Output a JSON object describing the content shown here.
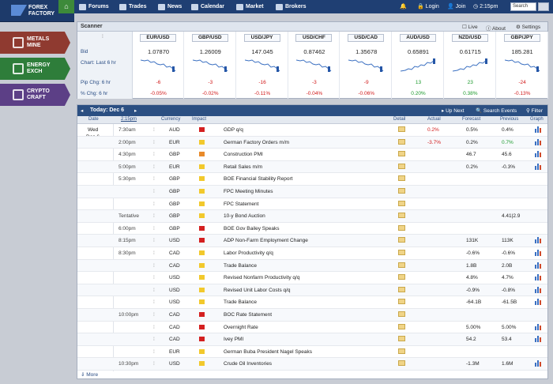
{
  "logo": {
    "line1": "FOREX",
    "line2": "FACTORY"
  },
  "nav": {
    "forums": "Forums",
    "trades": "Trades",
    "news": "News",
    "calendar": "Calendar",
    "market": "Market",
    "brokers": "Brokers",
    "login": "Login",
    "join": "Join",
    "time": "2:15pm",
    "search_placeholder": "Search"
  },
  "sidebar": [
    {
      "l1": "METALS",
      "l2": "MINE",
      "color": "#8f3a30"
    },
    {
      "l1": "ENERGY",
      "l2": "EXCH",
      "color": "#2e7d3a"
    },
    {
      "l1": "CRYPTO",
      "l2": "CRAFT",
      "color": "#5c3f86"
    }
  ],
  "scanner": {
    "title": "Scanner",
    "live": "Live",
    "about": "About",
    "settings": "Settings",
    "labels": {
      "bid": "Bid",
      "chart": "Chart: Last 6 hr",
      "pip": "Pip Chg: 6 hr",
      "pct": "% Chg: 6 hr"
    },
    "pairs": [
      {
        "name": "EUR/USD",
        "price": "1.07870",
        "pip": "-6",
        "pct": "-0.05%",
        "trend": "down"
      },
      {
        "name": "GBP/USD",
        "price": "1.26009",
        "pip": "-3",
        "pct": "-0.02%",
        "trend": "down"
      },
      {
        "name": "USD/JPY",
        "price": "147.045",
        "pip": "-16",
        "pct": "-0.11%",
        "trend": "down"
      },
      {
        "name": "USD/CHF",
        "price": "0.87462",
        "pip": "-3",
        "pct": "-0.04%",
        "trend": "down"
      },
      {
        "name": "USD/CAD",
        "price": "1.35678",
        "pip": "-9",
        "pct": "-0.06%",
        "trend": "down"
      },
      {
        "name": "AUD/USD",
        "price": "0.65891",
        "pip": "13",
        "pct": "0.20%",
        "trend": "up"
      },
      {
        "name": "NZD/USD",
        "price": "0.61715",
        "pip": "23",
        "pct": "0.38%",
        "trend": "up"
      },
      {
        "name": "GBP/JPY",
        "price": "185.281",
        "pip": "-24",
        "pct": "-0.13%",
        "trend": "down"
      }
    ]
  },
  "calendar": {
    "title": "Today: Dec 6",
    "up_next": "Up Next",
    "search_events": "Search Events",
    "filter": "Filter",
    "cols": {
      "date": "Date",
      "time": "2:15pm",
      "currency": "Currency",
      "impact": "Impact",
      "detail": "Detail",
      "actual": "Actual",
      "forecast": "Forecast",
      "previous": "Previous",
      "graph": "Graph"
    },
    "date_l1": "Wed",
    "date_l2": "Dec 6",
    "more": "More",
    "rows": [
      {
        "time": "7:30am",
        "cur": "AUD",
        "impact": "red",
        "event": "GDP q/q",
        "actual": "0.2%",
        "actual_neg": true,
        "forecast": "0.5%",
        "previous": "0.4%",
        "prev_pos": false,
        "graph": true
      },
      {
        "time": "2:00pm",
        "cur": "EUR",
        "impact": "yel",
        "event": "German Factory Orders m/m",
        "actual": "-3.7%",
        "actual_neg": true,
        "forecast": "0.2%",
        "previous": "0.7%",
        "prev_pos": true,
        "graph": true
      },
      {
        "time": "4:30pm",
        "cur": "GBP",
        "impact": "org",
        "event": "Construction PMI",
        "actual": "",
        "forecast": "46.7",
        "previous": "45.6",
        "graph": true
      },
      {
        "time": "5:00pm",
        "cur": "EUR",
        "impact": "yel",
        "event": "Retail Sales m/m",
        "actual": "",
        "forecast": "0.2%",
        "previous": "-0.3%",
        "graph": true
      },
      {
        "time": "5:30pm",
        "cur": "GBP",
        "impact": "yel",
        "event": "BOE Financial Stability Report",
        "actual": "",
        "forecast": "",
        "previous": "",
        "graph": false
      },
      {
        "time": "",
        "cur": "GBP",
        "impact": "yel",
        "event": "FPC Meeting Minutes",
        "actual": "",
        "forecast": "",
        "previous": "",
        "graph": false
      },
      {
        "time": "",
        "cur": "GBP",
        "impact": "yel",
        "event": "FPC Statement",
        "actual": "",
        "forecast": "",
        "previous": "",
        "graph": false
      },
      {
        "time": "Tentative",
        "cur": "GBP",
        "impact": "yel",
        "event": "10-y Bond Auction",
        "actual": "",
        "forecast": "",
        "previous": "4.41|2.9",
        "graph": false
      },
      {
        "time": "6:00pm",
        "cur": "GBP",
        "impact": "red",
        "event": "BOE Gov Bailey Speaks",
        "actual": "",
        "forecast": "",
        "previous": "",
        "graph": false
      },
      {
        "time": "8:15pm",
        "cur": "USD",
        "impact": "red",
        "event": "ADP Non-Farm Employment Change",
        "actual": "",
        "forecast": "131K",
        "previous": "113K",
        "graph": true
      },
      {
        "time": "8:30pm",
        "cur": "CAD",
        "impact": "yel",
        "event": "Labor Productivity q/q",
        "actual": "",
        "forecast": "-0.6%",
        "previous": "-0.6%",
        "graph": true
      },
      {
        "time": "",
        "cur": "CAD",
        "impact": "yel",
        "event": "Trade Balance",
        "actual": "",
        "forecast": "1.8B",
        "previous": "2.0B",
        "graph": true
      },
      {
        "time": "",
        "cur": "USD",
        "impact": "yel",
        "event": "Revised Nonfarm Productivity q/q",
        "actual": "",
        "forecast": "4.8%",
        "previous": "4.7%",
        "graph": true
      },
      {
        "time": "",
        "cur": "USD",
        "impact": "yel",
        "event": "Revised Unit Labor Costs q/q",
        "actual": "",
        "forecast": "-0.9%",
        "previous": "-0.8%",
        "graph": true
      },
      {
        "time": "",
        "cur": "USD",
        "impact": "yel",
        "event": "Trade Balance",
        "actual": "",
        "forecast": "-64.1B",
        "previous": "-61.5B",
        "graph": true
      },
      {
        "time": "10:00pm",
        "cur": "CAD",
        "impact": "red",
        "event": "BOC Rate Statement",
        "actual": "",
        "forecast": "",
        "previous": "",
        "graph": false
      },
      {
        "time": "",
        "cur": "CAD",
        "impact": "red",
        "event": "Overnight Rate",
        "actual": "",
        "forecast": "5.00%",
        "previous": "5.00%",
        "graph": true
      },
      {
        "time": "",
        "cur": "CAD",
        "impact": "red",
        "event": "Ivey PMI",
        "actual": "",
        "forecast": "54.2",
        "previous": "53.4",
        "graph": true
      },
      {
        "time": "",
        "cur": "EUR",
        "impact": "yel",
        "event": "German Buba President Nagel Speaks",
        "actual": "",
        "forecast": "",
        "previous": "",
        "graph": false
      },
      {
        "time": "10:30pm",
        "cur": "USD",
        "impact": "yel",
        "event": "Crude Oil Inventories",
        "actual": "",
        "forecast": "-1.3M",
        "previous": "1.6M",
        "graph": true
      }
    ]
  }
}
